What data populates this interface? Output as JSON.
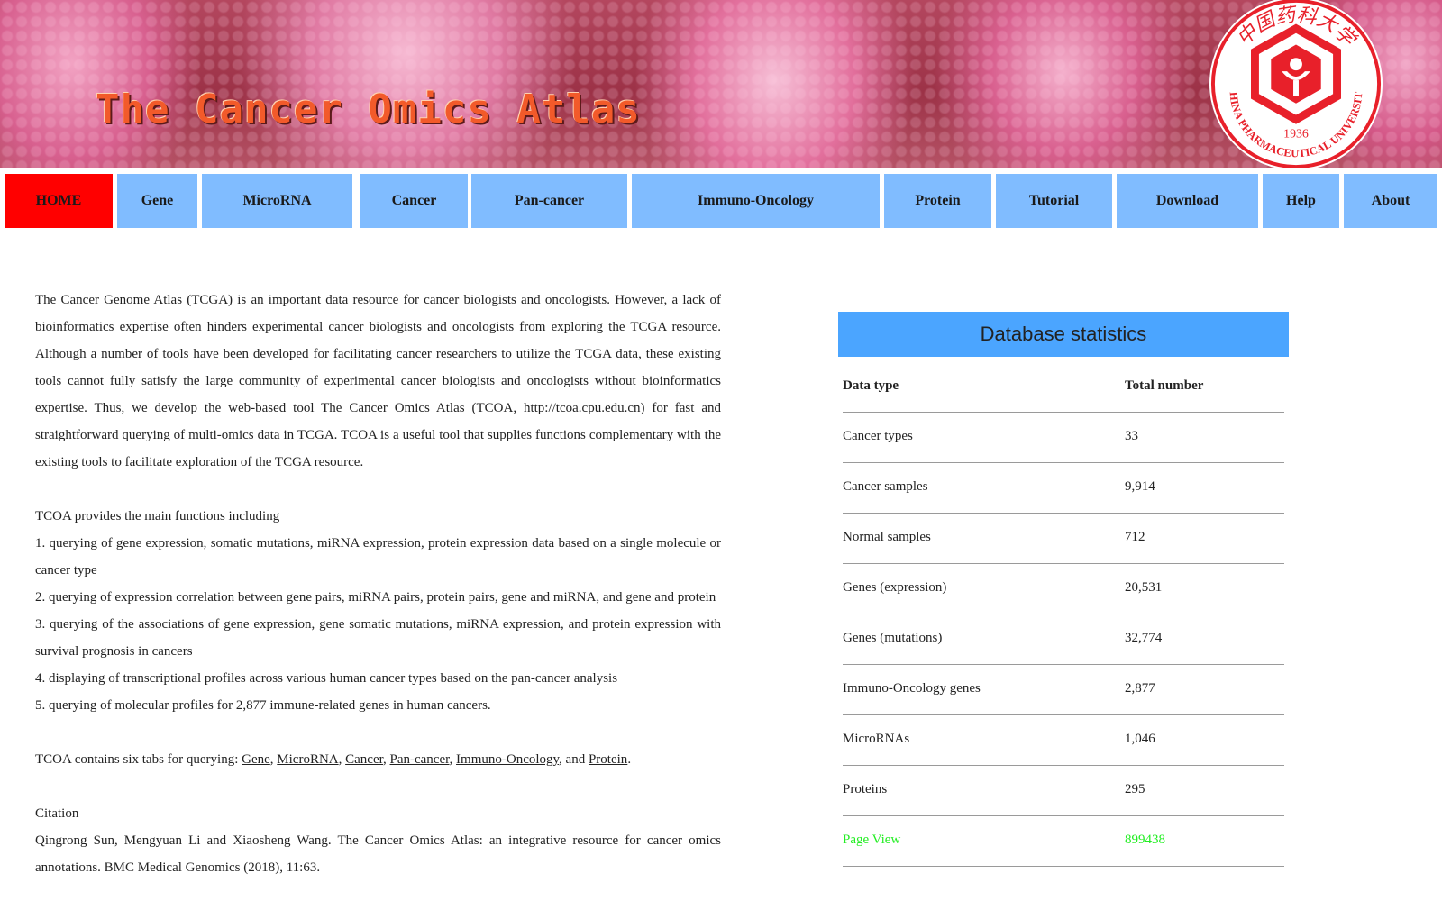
{
  "banner": {
    "title": "The Cancer Omics Atlas",
    "logo": {
      "icon": "china-pharmaceutical-university-seal-icon",
      "top_text": "中国药科大学",
      "bottom_text": "CHINA PHARMACEUTICAL UNIVERSITY",
      "year": "1936",
      "color": "#e8202a"
    }
  },
  "nav": {
    "items": [
      {
        "label": "HOME",
        "active": true
      },
      {
        "label": "Gene"
      },
      {
        "label": "MicroRNA"
      },
      {
        "label": "Cancer"
      },
      {
        "label": "Pan-cancer"
      },
      {
        "label": "Immuno-Oncology"
      },
      {
        "label": "Protein"
      },
      {
        "label": "Tutorial"
      },
      {
        "label": "Download"
      },
      {
        "label": "Help"
      },
      {
        "label": "About"
      }
    ],
    "colors": {
      "default": "#80bcff",
      "active": "#ff0000"
    }
  },
  "intro": {
    "paragraph": "The Cancer Genome Atlas (TCGA) is an important data resource for cancer biologists and oncologists. However, a lack of bioinformatics expertise often hinders experimental cancer biologists and oncologists from exploring the TCGA resource. Although a number of tools have been developed for facilitating cancer researchers to utilize the TCGA data, these existing tools cannot fully satisfy the large community of experimental cancer biologists and oncologists without bioinformatics expertise. Thus, we develop the web-based tool The Cancer Omics Atlas (TCOA, http://tcoa.cpu.edu.cn) for fast and straightforward querying of multi-omics data in TCGA. TCOA is a useful tool that supplies functions complementary with the existing tools to facilitate exploration of the TCGA resource.",
    "functions_heading": "TCOA provides the main functions including",
    "functions": [
      "1. querying of gene expression, somatic mutations, miRNA expression, protein expression data based on a single molecule or cancer type",
      "2. querying of expression correlation between gene pairs, miRNA pairs, protein pairs, gene and miRNA, and gene and protein",
      "3. querying of the associations of gene expression, gene somatic mutations, miRNA expression, and protein expression with survival prognosis in cancers",
      "4. displaying of transcriptional profiles across various human cancer types based on the pan-cancer analysis",
      "5. querying of molecular profiles for 2,877 immune-related genes in human cancers."
    ],
    "tabs_sentence": {
      "prefix": "TCOA contains six tabs for querying: ",
      "links": [
        "Gene",
        "MicroRNA",
        "Cancer",
        "Pan-cancer",
        "Immuno-Oncology",
        "Protein"
      ],
      "sep": ", ",
      "and": ", and ",
      "suffix": "."
    },
    "citation_heading": "Citation",
    "citation": "Qingrong Sun, Mengyuan Li and Xiaosheng Wang. The Cancer Omics Atlas: an integrative resource for cancer omics annotations. BMC Medical Genomics (2018), 11:63."
  },
  "stats": {
    "title": "Database statistics",
    "header_color": "#4ba5ff",
    "columns": [
      "Data type",
      "Total number"
    ],
    "rows": [
      [
        "Cancer types",
        "33"
      ],
      [
        "Cancer samples",
        "9,914"
      ],
      [
        "Normal samples",
        "712"
      ],
      [
        "Genes (expression)",
        "20,531"
      ],
      [
        "Genes (mutations)",
        "32,774"
      ],
      [
        "Immuno-Oncology genes",
        "2,877"
      ],
      [
        "MicroRNAs",
        "1,046"
      ],
      [
        "Proteins",
        "295"
      ]
    ],
    "page_view": {
      "label": "Page View",
      "value": "899438",
      "color": "#22ee22"
    }
  }
}
